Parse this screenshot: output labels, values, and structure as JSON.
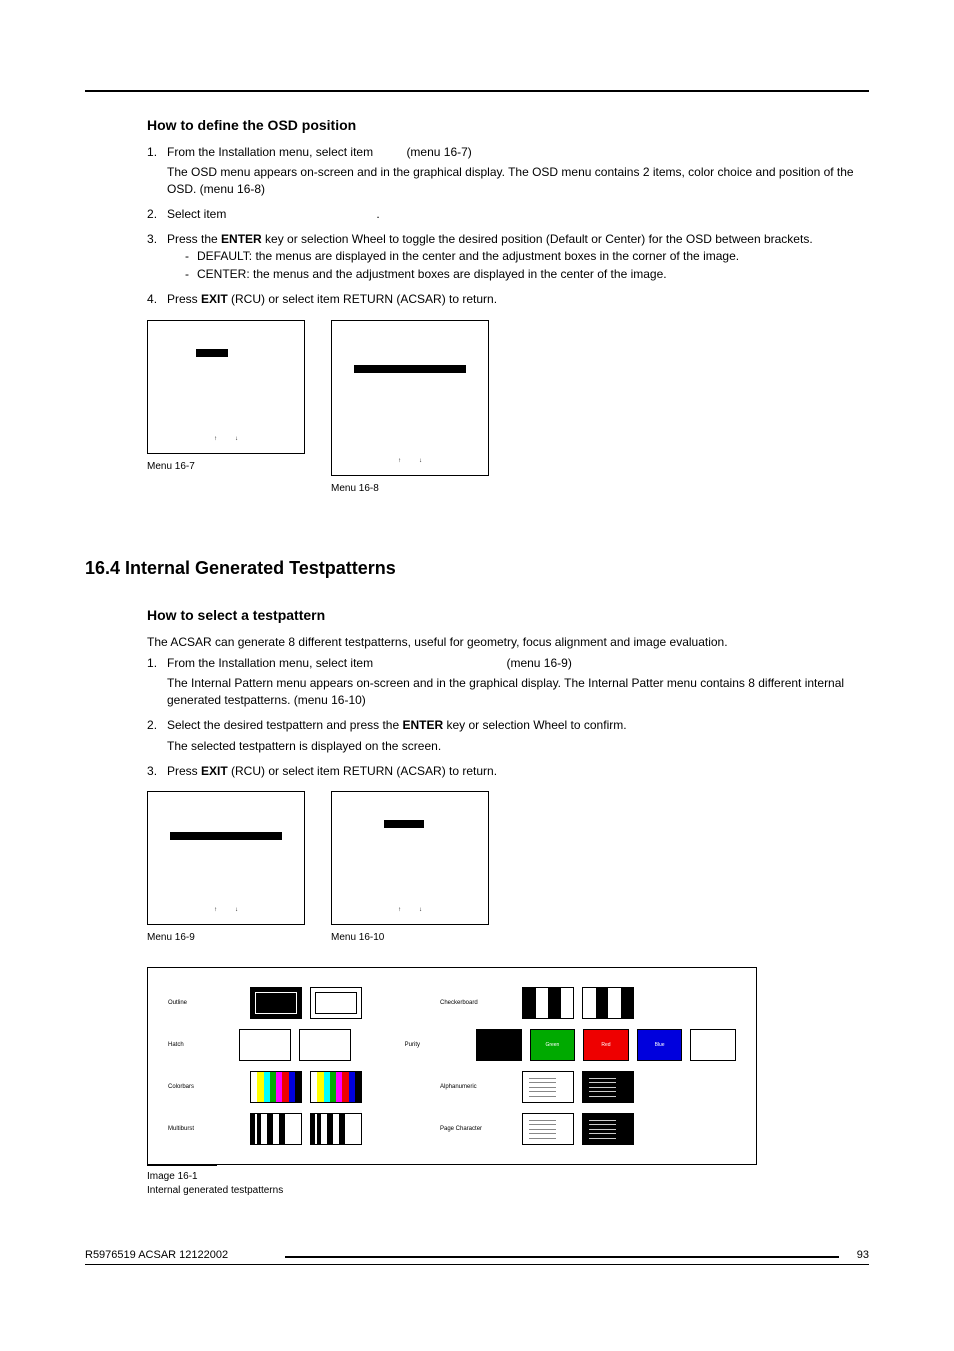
{
  "section1": {
    "title": "How to define the OSD position",
    "steps": [
      {
        "text": "From the Installation menu, select item",
        "tail": "(menu 16-7)",
        "sub": "The OSD menu appears on-screen and in the graphical display. The OSD menu contains 2 items, color choice and position of the OSD. (menu 16-8)"
      },
      {
        "text": "Select item",
        "tail": "."
      },
      {
        "text_pre": "Press the ",
        "bold": "ENTER",
        "text_post": " key or selection Wheel to toggle the desired position (Default or Center) for the OSD between brackets.",
        "bullets": [
          "DEFAULT: the menus are displayed in the center and the adjustment boxes in the corner of the image.",
          "CENTER: the menus and the adjustment boxes are displayed in the center of the image."
        ]
      },
      {
        "text_pre": "Press ",
        "bold": "EXIT",
        "text_post": " (RCU) or select item RETURN (ACSAR) to return."
      }
    ],
    "menu_a": "Menu 16-7",
    "menu_b": "Menu 16-8",
    "arrows": {
      "up": "↑",
      "down": "↓"
    }
  },
  "section2": {
    "heading": "16.4 Internal Generated Testpatterns",
    "title": "How to select a testpattern",
    "intro": "The ACSAR can generate 8 different testpatterns, useful for geometry, focus alignment and image evaluation.",
    "steps": [
      {
        "text": "From the Installation menu, select item",
        "tail": "(menu 16-9)",
        "sub": "The Internal Pattern menu appears on-screen and in the graphical display. The Internal Patter menu contains 8 different internal generated testpatterns.  (menu 16-10)"
      },
      {
        "text_pre": "Select the desired testpattern and press the ",
        "bold": "ENTER",
        "text_post": " key or selection Wheel to confirm.",
        "sub": "The selected testpattern is displayed on the screen."
      },
      {
        "text_pre": "Press ",
        "bold": "EXIT",
        "text_post": " (RCU) or select item RETURN (ACSAR) to return."
      }
    ],
    "menu_a": "Menu 16-9",
    "menu_b": "Menu 16-10",
    "arrows": {
      "up": "↑",
      "down": "↓"
    }
  },
  "testpatterns": {
    "rows": [
      {
        "l": "Outline",
        "r": "Checkerboard"
      },
      {
        "l": "Hatch",
        "r": "Purity"
      },
      {
        "l": "Colorbars",
        "r": "Alphanumeric"
      },
      {
        "l": "Multiburst",
        "r": "Page Character"
      }
    ],
    "purity": {
      "g": "Green",
      "r": "Red",
      "b": "Blue"
    },
    "caption": "Image 16-1",
    "sub": "Internal generated testpatterns"
  },
  "footer": {
    "left": "R5976519  ACSAR  12122002",
    "right": "93"
  }
}
